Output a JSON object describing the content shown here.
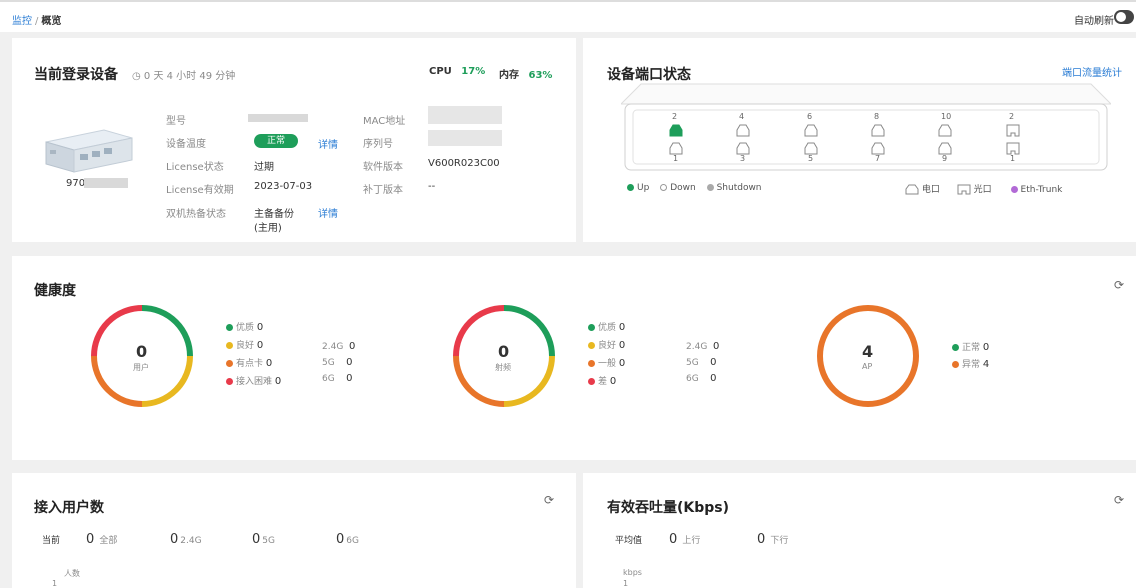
{
  "breadcrumb": {
    "parent": "监控",
    "separator": "/",
    "current": "概览"
  },
  "auto_refresh": {
    "label": "自动刷新",
    "enabled": true
  },
  "device": {
    "title": "当前登录设备",
    "uptime": "0 天 4 小时 49 分钟",
    "cpu_label": "CPU",
    "cpu_value": "17%",
    "mem_label": "内存",
    "mem_value": "63%",
    "name_prefix": "970",
    "fields": {
      "model_label": "型号",
      "temp_label": "设备温度",
      "temp_status": "正常",
      "temp_link": "详情",
      "license_label": "License状态",
      "license_value": "过期",
      "license_exp_label": "License有效期",
      "license_exp_value": "2023-07-03",
      "ha_label": "双机热备状态",
      "ha_value": "主备备份",
      "ha_value2": "(主用)",
      "ha_link": "详情",
      "mac_label": "MAC地址",
      "serial_label": "序列号",
      "sw_label": "软件版本",
      "sw_value": "V600R023C00",
      "patch_label": "补丁版本",
      "patch_value": "--"
    }
  },
  "ports": {
    "title": "设备端口状态",
    "link": "端口流量统计",
    "top_numbers": [
      "2",
      "4",
      "6",
      "8",
      "10",
      "2"
    ],
    "bottom_numbers": [
      "1",
      "3",
      "5",
      "7",
      "9",
      "1"
    ],
    "legend": {
      "up": "Up",
      "down": "Down",
      "shutdown": "Shutdown",
      "electric": "电口",
      "optical": "光口",
      "trunk": "Eth-Trunk"
    },
    "colors": {
      "up": "#1e9e5a",
      "down": "#999999",
      "trunk": "#b26ad6"
    }
  },
  "health": {
    "title": "健康度",
    "users": {
      "value": "0",
      "label": "用户",
      "items": [
        {
          "label": "优质",
          "value": "0",
          "color": "#1e9e5a"
        },
        {
          "label": "良好",
          "value": "0",
          "color": "#e8b820"
        },
        {
          "label": "有点卡",
          "value": "0",
          "color": "#e8752a"
        },
        {
          "label": "接入困难",
          "value": "0",
          "color": "#e83a4a"
        }
      ],
      "bands": [
        {
          "label": "2.4G",
          "value": "0"
        },
        {
          "label": "5G",
          "value": "0"
        },
        {
          "label": "6G",
          "value": "0"
        }
      ]
    },
    "radio": {
      "value": "0",
      "label": "射频",
      "items": [
        {
          "label": "优质",
          "value": "0",
          "color": "#1e9e5a"
        },
        {
          "label": "良好",
          "value": "0",
          "color": "#e8b820"
        },
        {
          "label": "一般",
          "value": "0",
          "color": "#e8752a"
        },
        {
          "label": "差",
          "value": "0",
          "color": "#e83a4a"
        }
      ],
      "bands": [
        {
          "label": "2.4G",
          "value": "0"
        },
        {
          "label": "5G",
          "value": "0"
        },
        {
          "label": "6G",
          "value": "0"
        }
      ]
    },
    "ap": {
      "value": "4",
      "label": "AP",
      "items": [
        {
          "label": "正常",
          "value": "0",
          "color": "#1e9e5a"
        },
        {
          "label": "异常",
          "value": "4",
          "color": "#e8752a"
        }
      ]
    }
  },
  "users_panel": {
    "title": "接入用户数",
    "current_label": "当前",
    "stats": [
      {
        "value": "0",
        "label": "全部"
      },
      {
        "value": "0",
        "label": "2.4G"
      },
      {
        "value": "0",
        "label": "5G"
      },
      {
        "value": "0",
        "label": "6G"
      }
    ],
    "y_unit": "人数",
    "y_tick": "1"
  },
  "throughput": {
    "title": "有效吞吐量(Kbps)",
    "avg_label": "平均值",
    "stats": [
      {
        "value": "0",
        "label": "上行"
      },
      {
        "value": "0",
        "label": "下行"
      }
    ],
    "y_unit": "kbps",
    "y_tick": "1"
  }
}
